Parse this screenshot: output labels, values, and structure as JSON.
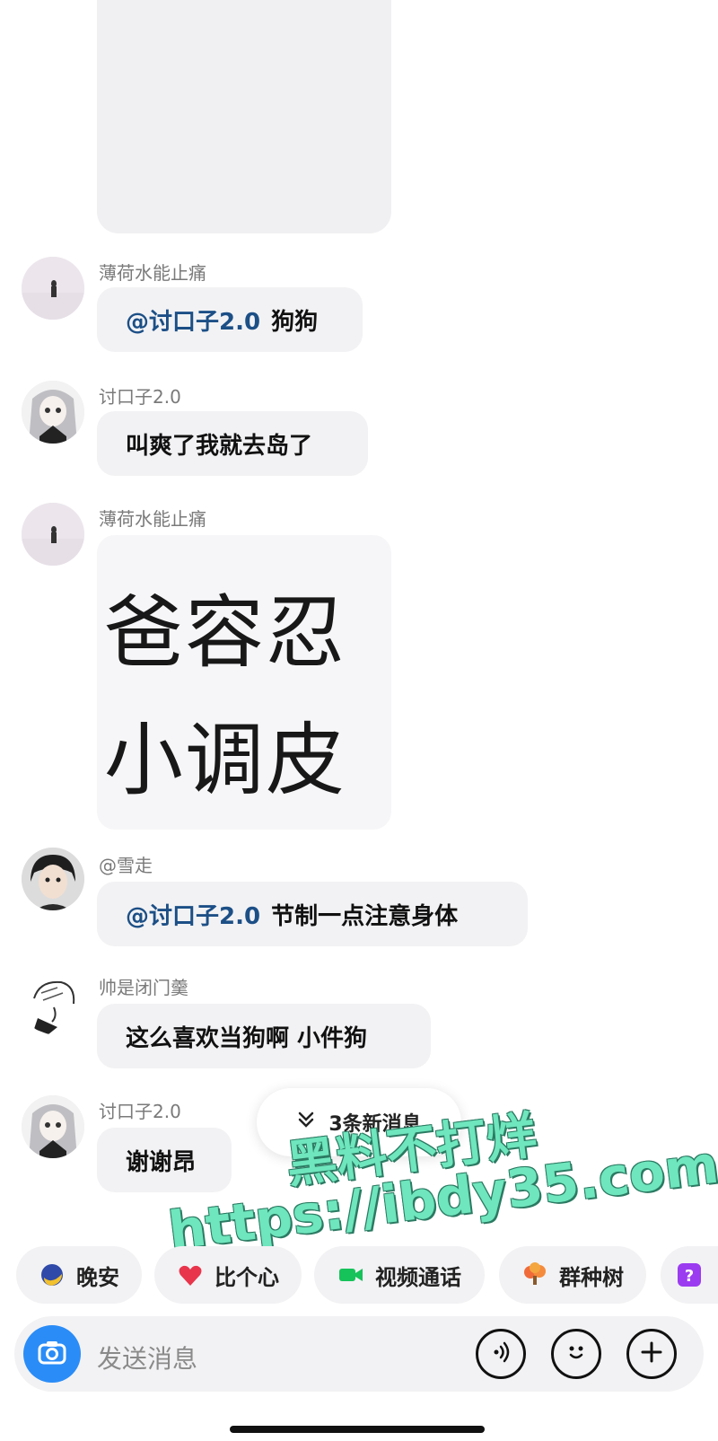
{
  "messages": [
    {
      "sender": "薄荷水能止痛",
      "mention": "@讨口子2.0",
      "text": "狗狗"
    },
    {
      "sender": "讨口子2.0",
      "text": "叫爽了我就去岛了"
    },
    {
      "sender": "薄荷水能止痛",
      "sticker_lines": [
        "爸容忍",
        "小调皮"
      ]
    },
    {
      "sender": "@雪走",
      "mention": "@讨口子2.0",
      "text": "节制一点注意身体"
    },
    {
      "sender": "帅是闭门羹",
      "text": "这么喜欢当狗啊 小件狗"
    },
    {
      "sender": "讨口子2.0",
      "text": "谢谢昂"
    }
  ],
  "new_messages_label": "3条新消息",
  "watermark": {
    "line1": "黑料不打烊",
    "line2": "https://ibdy35.com"
  },
  "quick_actions": [
    {
      "label": "晚安",
      "icon": "moon-icon"
    },
    {
      "label": "比个心",
      "icon": "heart-icon"
    },
    {
      "label": "视频通话",
      "icon": "video-call-icon"
    },
    {
      "label": "群种树",
      "icon": "tree-icon"
    },
    {
      "label": "",
      "icon": "question-icon"
    }
  ],
  "input": {
    "placeholder": "发送消息"
  },
  "colors": {
    "mention": "#1c4f86",
    "bubble": "#f2f2f4",
    "watermark": "#6fe6bd",
    "camera": "#2a8cf7"
  }
}
